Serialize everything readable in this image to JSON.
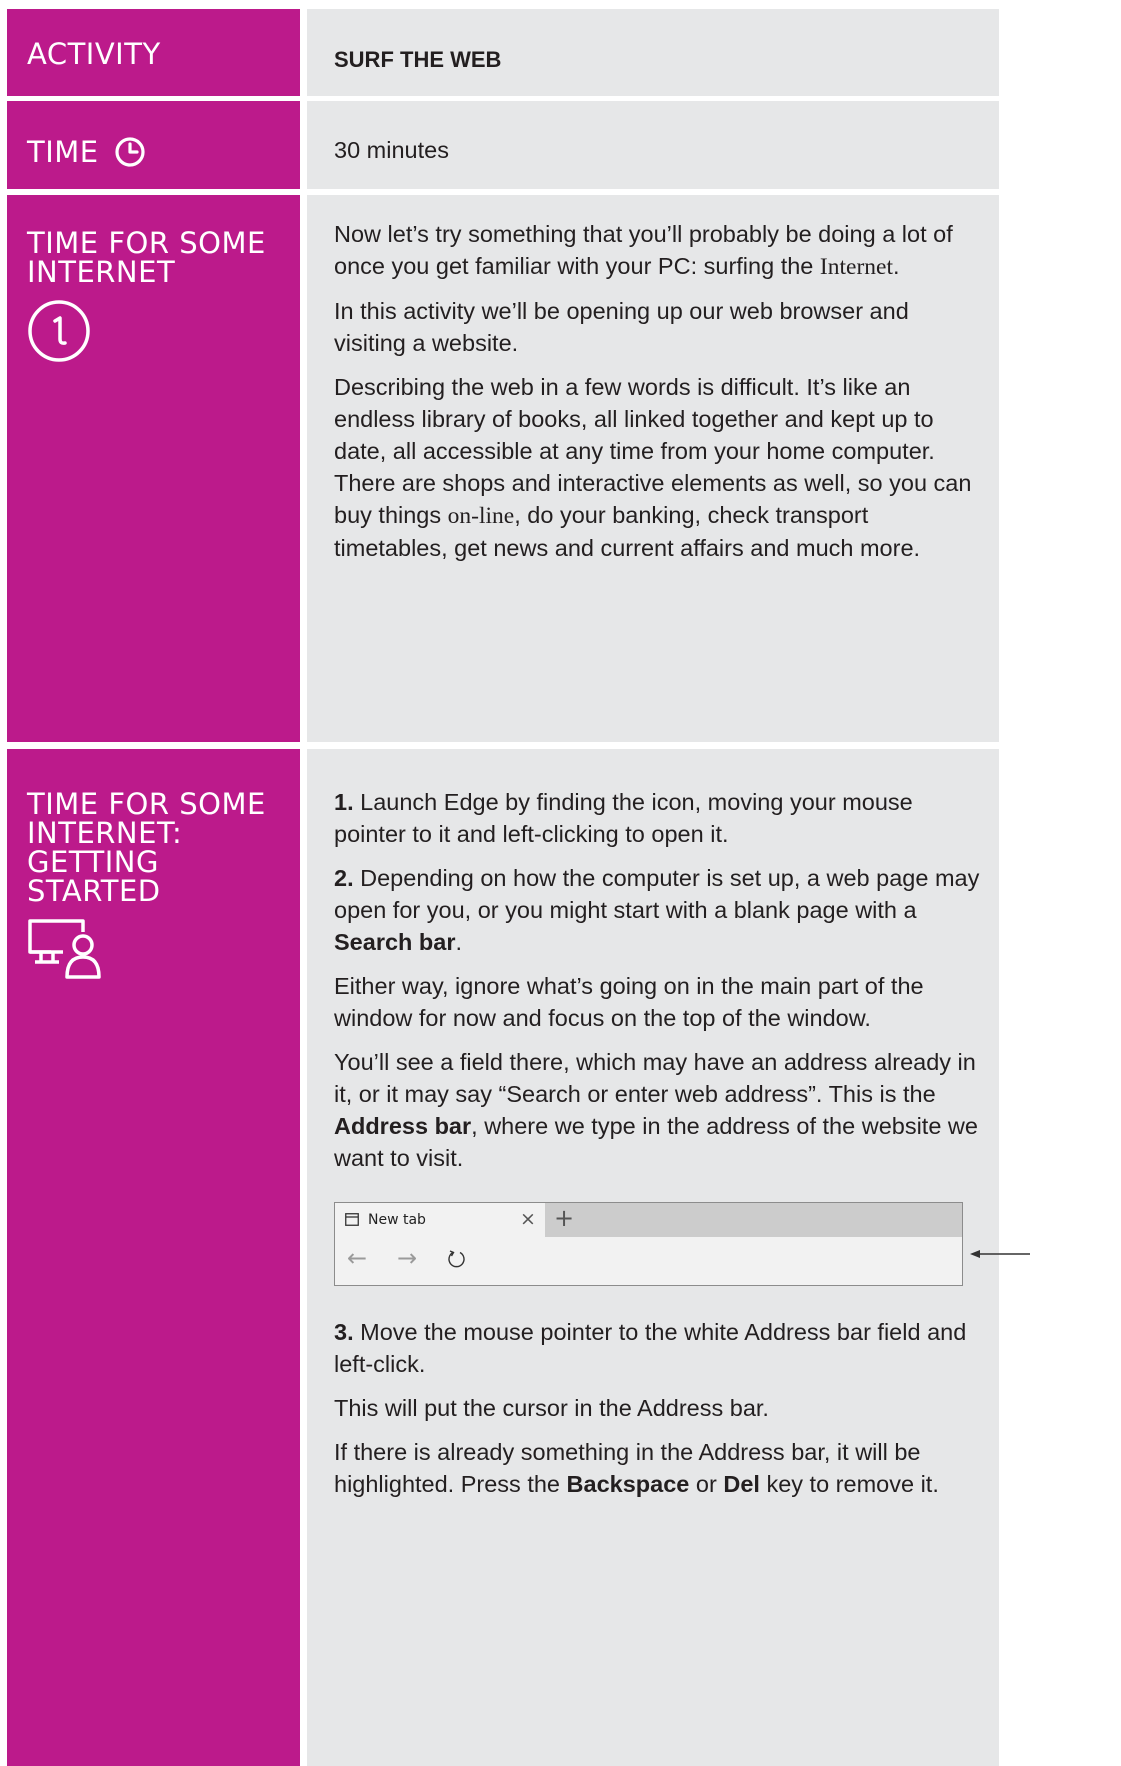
{
  "rows": {
    "activity": {
      "label": "ACTIVITY",
      "value": "SURF THE WEB"
    },
    "time": {
      "label": "TIME",
      "value": "30 minutes",
      "icon": "clock-icon"
    },
    "internet": {
      "label_line1": "TIME FOR SOME",
      "label_line2": "INTERNET",
      "icon": "info-circle-icon",
      "p1_a": "Now let’s try something that you’ll probably be doing a lot of once you get familiar with your PC: surfing the ",
      "p1_b": "Internet",
      "p1_c": ".",
      "p2": "In this activity we’ll be opening up our web browser and visiting a website.",
      "p3_a": "Describing the web in a few words is difficult. It’s like an endless library of books, all linked together and kept up to date, all accessible at any time from your home computer. There are shops and interactive elements as well, so you can buy things ",
      "p3_b": "on-line",
      "p3_c": ", do your banking, check transport timetables, get news and current affairs and much more."
    },
    "getting_started": {
      "label_line1": "TIME FOR SOME",
      "label_line2": "INTERNET: GETTING",
      "label_line3": "STARTED",
      "icon": "computer-user-icon",
      "s1_num": "1.",
      "s1_text": " Launch Edge by finding the icon, moving your mouse pointer to it and left-clicking to open it.",
      "s2_num": "2.",
      "s2_text": " Depending on how the computer is set up, a web page may open for you, or you might start with a blank page with a ",
      "s2_bold": "Search bar",
      "s2_end": ".",
      "p_either": "Either way, ignore what’s going on in the main part of the window for now and focus on the top of the window.",
      "p_field_a": "You’ll see a field there, which may have an address already in it, or it may say “Search or enter web address”. This is the ",
      "p_field_bold": "Address bar",
      "p_field_c": ", where we type in the address of the website we want to visit.",
      "browser": {
        "tab_title": "New tab",
        "close_glyph": "×",
        "new_tab_glyph": "+",
        "back_glyph": "←",
        "forward_glyph": "→"
      },
      "s3_num": "3.",
      "s3_text": " Move the mouse pointer to the white Address bar field and left-click.",
      "p_cursor": "This will put the cursor in the Address bar.",
      "p_highlight_a": "If there is already something in the Address bar, it will be highlighted. Press the ",
      "p_highlight_b1": "Backspace",
      "p_highlight_or": " or ",
      "p_highlight_b2": "Del",
      "p_highlight_c": " key to remove it."
    }
  },
  "colors": {
    "label_bg": "#bc1a8b",
    "cell_bg": "#e6e7e8",
    "label_text": "#ffffff",
    "body_text": "#231f20"
  }
}
